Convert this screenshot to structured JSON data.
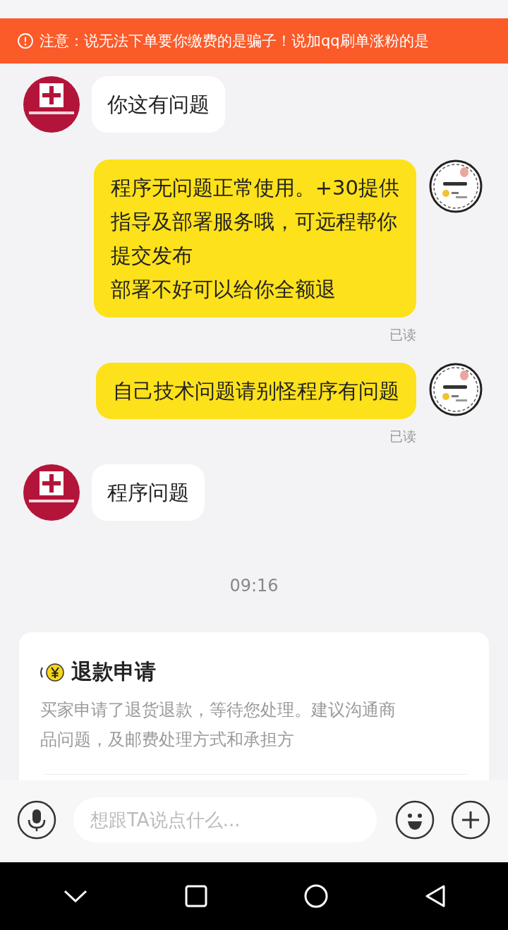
{
  "notice": {
    "text": "注意：说无法下单要你缴费的是骗子！说加qq刷单涨粉的是"
  },
  "messages": [
    {
      "kind": "incoming",
      "lines": [
        "你这有问题"
      ]
    },
    {
      "kind": "outgoing",
      "lines": [
        "程序无问题正常使用。+30提供",
        "指导及部署服务哦，可远程帮你",
        "提交发布",
        "部署不好可以给你全额退"
      ],
      "status": "已读"
    },
    {
      "kind": "outgoing",
      "lines": [
        "自己技术问题请别怪程序有问题"
      ],
      "status": "已读"
    },
    {
      "kind": "incoming",
      "lines": [
        "程序问题"
      ]
    },
    {
      "kind": "time",
      "text": "09:16"
    }
  ],
  "refund_card": {
    "title": "退款申请",
    "description": "买家申请了退货退款，等待您处理。建议沟通商品问题，及邮费处理方式和承担方"
  },
  "composer": {
    "placeholder": "想跟TA说点什么..."
  }
}
